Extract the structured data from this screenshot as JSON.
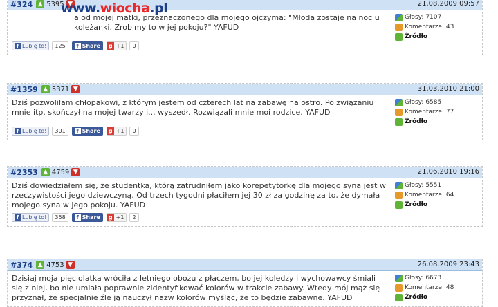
{
  "logo": {
    "prefix": "www.",
    "name": "wiocha",
    "suffix": ".pl"
  },
  "ui": {
    "votes_label": "Głosy:",
    "comments_label": "Komentarze:",
    "source_label": "Źródło",
    "like_label": "Lubię to!",
    "share_label": "Share",
    "gplus_label": "+1",
    "thumb_up_glyph": "▲",
    "thumb_down_glyph": "▼",
    "fb_glyph": "f",
    "g_glyph": "g"
  },
  "posts": [
    {
      "id": "#324",
      "up": "5395",
      "date": "21.08.2009 09:57",
      "text": "a od mojej matki, przeznaczonego dla mojego ojczyma: \"Młoda zostaje na noc u koleżanki. Zrobimy to w jej pokoju?\" YAFUD",
      "votes": "7107",
      "comments": "43",
      "likes": "125",
      "plus": "0"
    },
    {
      "id": "#1359",
      "up": "5371",
      "date": "31.03.2010 21:00",
      "text": "Dziś pozwoliłam chłopakowi, z którym jestem od czterech lat na zabawę na ostro. Po związaniu mnie itp. skończył na mojej twarzy i... wyszedł. Rozwiązali mnie moi rodzice. YAFUD",
      "votes": "6585",
      "comments": "77",
      "likes": "301",
      "plus": "0"
    },
    {
      "id": "#2353",
      "up": "4759",
      "date": "21.06.2010 19:16",
      "text": "Dziś dowiedziałem się, że studentka, którą zatrudniłem jako korepetytorkę dla mojego syna jest w rzeczywistości jego dziewczyną. Od trzech tygodni płaciłem jej 30 zł za godzinę za to, że dymała mojego syna w jego pokoju. YAFUD",
      "votes": "5551",
      "comments": "64",
      "likes": "358",
      "plus": "2"
    },
    {
      "id": "#374",
      "up": "4753",
      "date": "26.08.2009 23:43",
      "text": "Dzisiaj moja pięciolatka wróciła z letniego obozu z płaczem, bo jej koledzy i wychowawcy śmiali się z niej, bo nie umiała poprawnie zidentyfikować kolorów w trakcie zabawy. Wtedy mój mąż się przyznał, że specjalnie źle ją nauczył nazw kolorów myśląc, że to będzie zabawne. YAFUD",
      "votes": "6673",
      "comments": "48",
      "likes": "",
      "plus": ""
    }
  ]
}
